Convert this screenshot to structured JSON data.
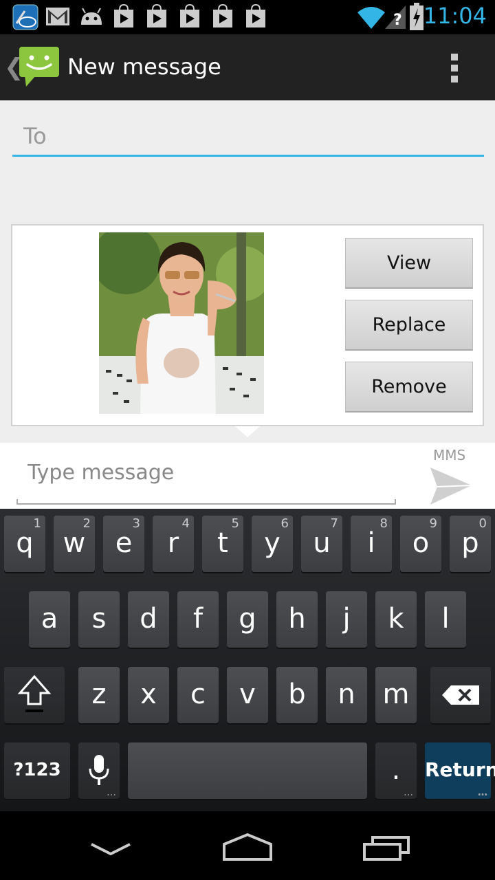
{
  "status_bar": {
    "time": "11:04",
    "icons": [
      "intel-app-icon",
      "gmail-icon",
      "android-debug-icon",
      "play-store-icon",
      "play-store-icon",
      "play-store-icon",
      "play-store-icon",
      "play-store-icon",
      "wifi-icon",
      "no-signal-icon",
      "battery-charging-icon"
    ],
    "time_color": "#33b5e5"
  },
  "action_bar": {
    "title": "New message"
  },
  "recipient": {
    "placeholder": "To"
  },
  "attachment": {
    "buttons": {
      "view": "View",
      "replace": "Replace",
      "remove": "Remove"
    }
  },
  "compose": {
    "placeholder": "Type message",
    "mms_label": "MMS"
  },
  "keyboard": {
    "row1": [
      {
        "label": "q",
        "hint": "1"
      },
      {
        "label": "w",
        "hint": "2"
      },
      {
        "label": "e",
        "hint": "3"
      },
      {
        "label": "r",
        "hint": "4"
      },
      {
        "label": "t",
        "hint": "5"
      },
      {
        "label": "y",
        "hint": "6"
      },
      {
        "label": "u",
        "hint": "7"
      },
      {
        "label": "i",
        "hint": "8"
      },
      {
        "label": "o",
        "hint": "9"
      },
      {
        "label": "p",
        "hint": "0"
      }
    ],
    "row2": [
      "a",
      "s",
      "d",
      "f",
      "g",
      "h",
      "j",
      "k",
      "l"
    ],
    "row3": [
      "z",
      "x",
      "c",
      "v",
      "b",
      "n",
      "m"
    ],
    "symbols_label": "?123",
    "period_label": ".",
    "return_label": "Return"
  },
  "colors": {
    "accent": "#33b5e5",
    "messaging_green": "#8cc63e"
  }
}
